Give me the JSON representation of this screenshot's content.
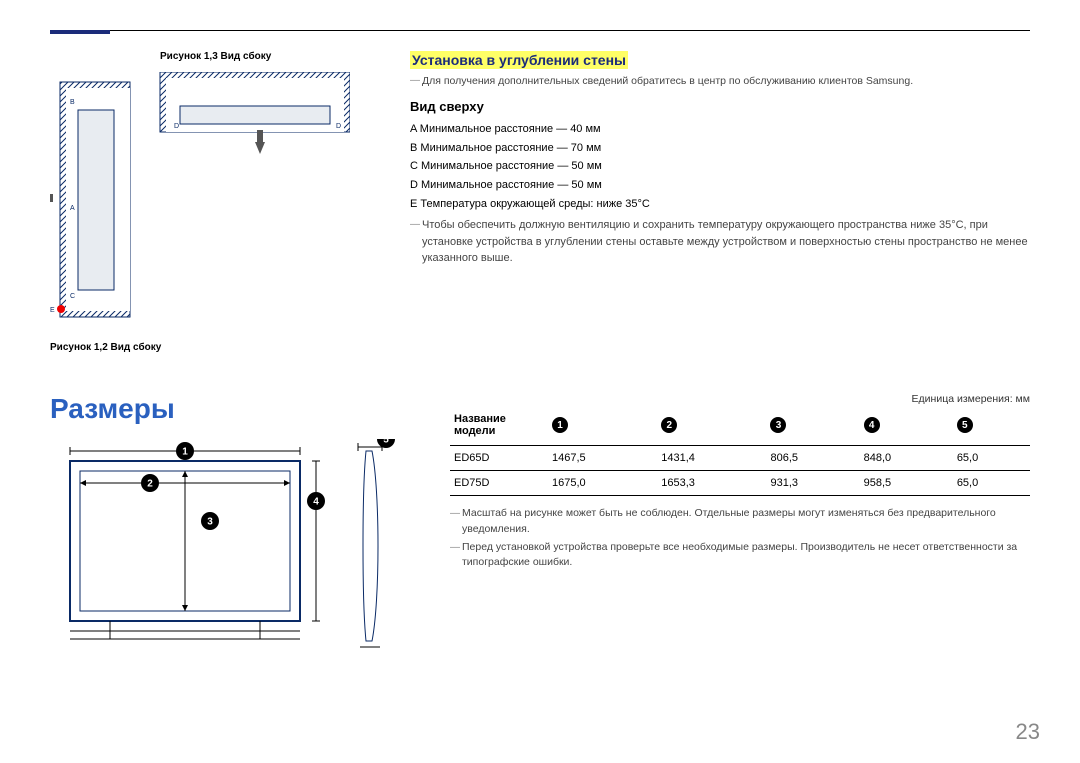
{
  "captions": {
    "fig13": "Рисунок 1,3 Вид сбоку",
    "fig12": "Рисунок 1,2 Вид сбоку"
  },
  "wall": {
    "heading": "Установка в углублении стены",
    "note": "Для получения дополнительных сведений обратитесь в центр по обслуживанию клиентов Samsung.",
    "top_view_title": "Вид сверху",
    "distances": {
      "A": {
        "label": "A",
        "text": "Минимальное расстояние — 40 мм"
      },
      "B": {
        "label": "B",
        "text": "Минимальное расстояние — 70 мм"
      },
      "C": {
        "label": "C",
        "text": "Минимальное расстояние — 50 мм"
      },
      "D": {
        "label": "D",
        "text": "Минимальное расстояние — 50 мм"
      },
      "E": {
        "label": "E",
        "text": "Температура окружающей среды: ниже 35°C"
      }
    },
    "long_note": "Чтобы обеспечить должную вентиляцию и сохранить температуру окружающего пространства ниже 35°C, при установке устройства в углублении стены оставьте между устройством и поверхностью стены пространство не менее указанного выше."
  },
  "dimensions": {
    "title": "Размеры",
    "unit_note": "Единица измерения: мм",
    "header_model": "Название модели",
    "rows": [
      {
        "model": "ED65D",
        "v1": "1467,5",
        "v2": "1431,4",
        "v3": "806,5",
        "v4": "848,0",
        "v5": "65,0"
      },
      {
        "model": "ED75D",
        "v1": "1675,0",
        "v2": "1653,3",
        "v3": "931,3",
        "v4": "958,5",
        "v5": "65,0"
      }
    ],
    "note1": "Масштаб на рисунке может быть не соблюден. Отдельные размеры могут изменяться без предварительного уведомления.",
    "note2": "Перед установкой устройства проверьте все необходимые размеры. Производитель не несет ответственности за типографские ошибки."
  },
  "page_number": "23",
  "icons": {
    "labels": {
      "A": "A",
      "B": "B",
      "C": "C",
      "D": "D",
      "E": "E"
    }
  }
}
